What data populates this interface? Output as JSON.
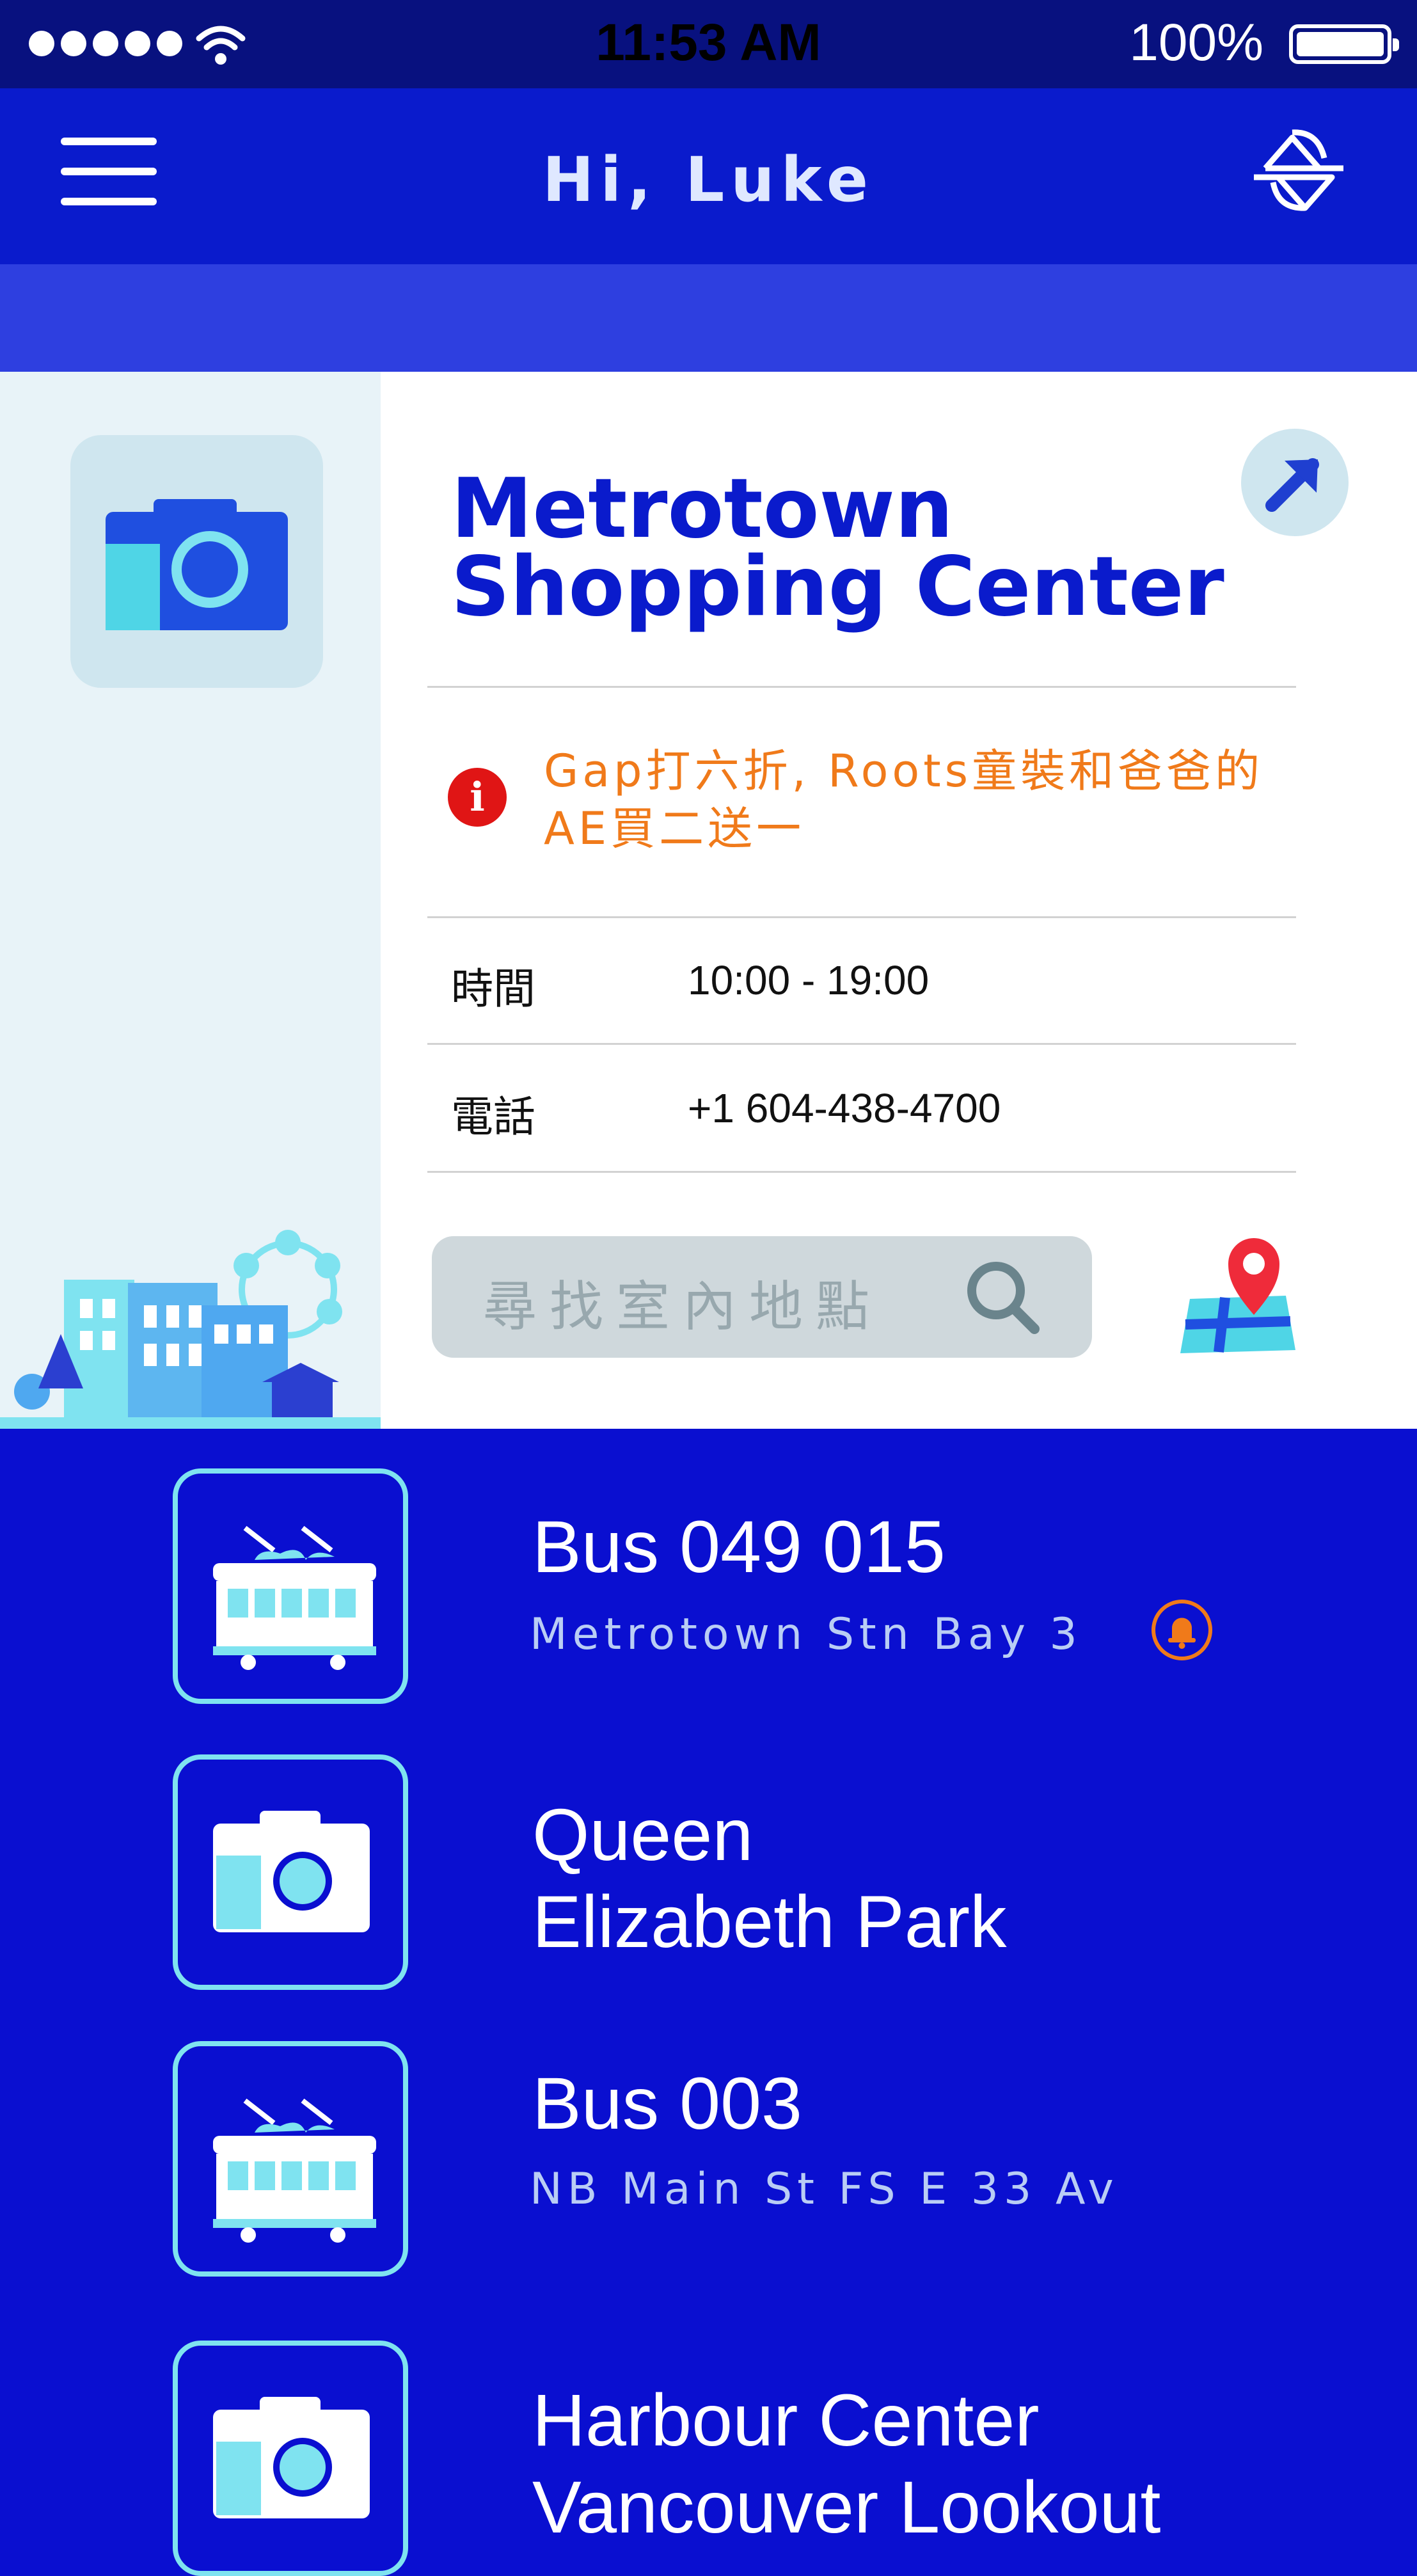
{
  "status_bar": {
    "time": "11:53 AM",
    "battery": "100%"
  },
  "header": {
    "greeting": "Hi, Luke"
  },
  "place": {
    "title_line1": "Metrotown",
    "title_line2": "Shopping  Center",
    "promo_line1": "Gap打六折, Roots童裝和爸爸的",
    "promo_line2": "AE買二送一",
    "hours_label": "時間",
    "hours_value": "10:00 - 19:00",
    "phone_label": "電話",
    "phone_value": "+1 604-438-4700",
    "search_placeholder": "尋找室內地點"
  },
  "list": [
    {
      "icon": "tram-icon",
      "title": "Bus  049    015",
      "subtitle": "Metrotown Stn Bay 3"
    },
    {
      "icon": "camera-icon",
      "title_line1": "Queen",
      "title_line2": "Elizabeth Park"
    },
    {
      "icon": "tram-icon",
      "title": "Bus  003",
      "subtitle": "NB Main St FS E 33 Av"
    },
    {
      "icon": "camera-icon",
      "title_line1": "Harbour Center",
      "title_line2": "Vancouver Lookout"
    }
  ],
  "colors": {
    "primary": "#0a1bcc",
    "accent": "#f07a1a",
    "alert": "#e01515",
    "cyan": "#7fe3f0"
  }
}
